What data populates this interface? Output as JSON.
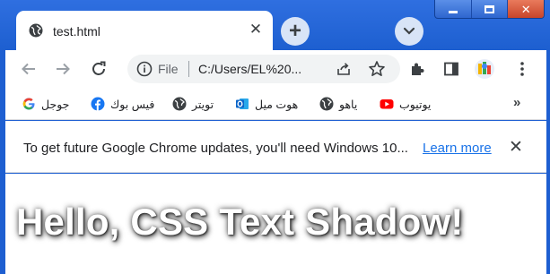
{
  "tab": {
    "title": "test.html",
    "close_glyph": "✕"
  },
  "new_tab_glyph": "+",
  "window_controls": {
    "close_glyph": "✕"
  },
  "address_bar": {
    "scheme_label": "File",
    "url": "C:/Users/EL%20..."
  },
  "bookmarks": [
    {
      "label": "جوجل",
      "icon": "google-icon"
    },
    {
      "label": "فيس بوك",
      "icon": "facebook-icon"
    },
    {
      "label": "تويتر",
      "icon": "globe-icon"
    },
    {
      "label": "هوت ميل",
      "icon": "outlook-icon"
    },
    {
      "label": "ياهو",
      "icon": "globe-icon"
    },
    {
      "label": "يوتيوب",
      "icon": "youtube-icon"
    }
  ],
  "bookmarks_more_glyph": "»",
  "infobar": {
    "message": "To get future Google Chrome updates, you'll need Windows 10...",
    "link": "Learn more",
    "close_glyph": "✕"
  },
  "page": {
    "heading": "Hello, CSS Text Shadow!"
  },
  "colors": {
    "frame": "#1e5fd1",
    "link": "#1a73e8",
    "youtube": "#ff0000",
    "facebook": "#1877f2",
    "outlook": "#0a64c8"
  }
}
